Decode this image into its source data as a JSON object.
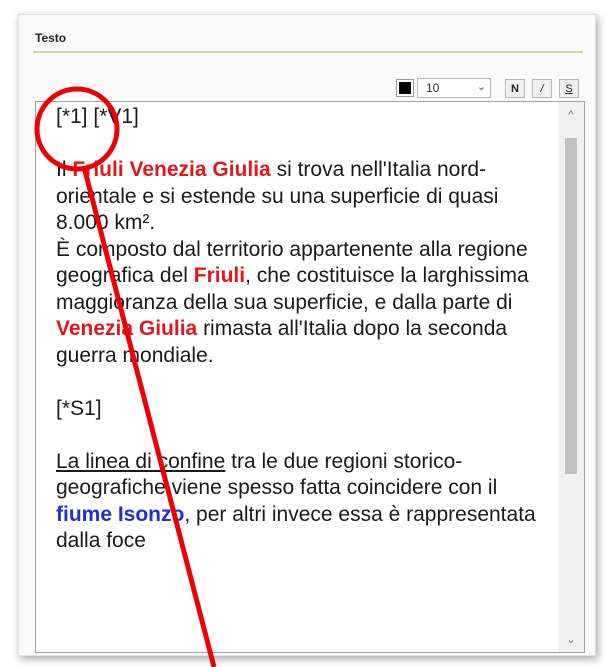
{
  "panel": {
    "title": "Testo"
  },
  "toolbar": {
    "color_value": "#000000",
    "size_value": "10",
    "size_chevron_icon": "chevron-down-icon",
    "bold_label": "N",
    "italic_label": "/",
    "underline_label": "S"
  },
  "editor": {
    "line1": "[*1] [*V1]",
    "p1_a": "Il ",
    "p1_red1": "Friuli Venezia Giulia",
    "p1_b": " si trova nell'Italia nord-orientale e si estende su una superficie di quasi 8.000 km².",
    "p2_a": "È composto dal territorio appartenente alla regione geografica del ",
    "p2_red1": "Friuli",
    "p2_b": ", che costituisce la larghissima maggioranza della sua superficie, e dalla parte di ",
    "p2_red2": "Venezia Giulia",
    "p2_c": " rimasta all'Italia dopo la seconda guerra mondiale.",
    "line_s1": "[*S1]",
    "p3_u": "La linea di confine",
    "p3_a": " tra le due regioni storico-geografiche viene spesso fatta coincidere con il ",
    "p3_blue": "fiume Isonzo",
    "p3_b": ", per altri invece essa è rappresentata dalla foce"
  },
  "scrollbar": {
    "up_icon": "scroll-up-arrow-icon",
    "down_icon": "scroll-down-arrow-icon",
    "up_glyph": "^",
    "down_glyph": "⌄"
  },
  "annotation": {
    "color": "#ee0000"
  }
}
